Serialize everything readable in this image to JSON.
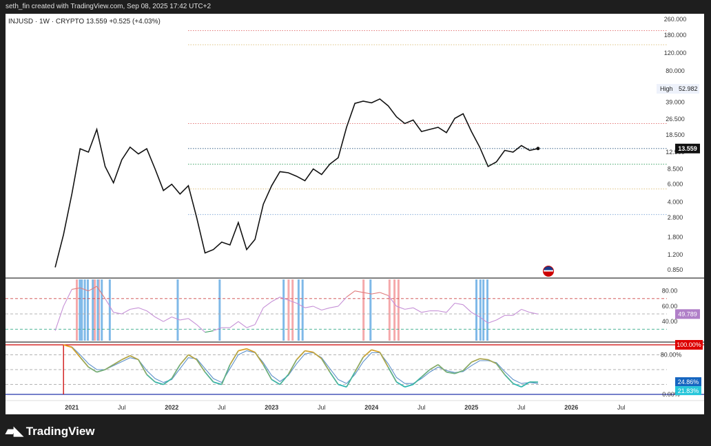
{
  "header_text": "seth_fin created with TradingView.com, Sep 08, 2025 17:42 UTC+2",
  "symbol_line": "INJUSD · 1W · CRYPTO  13.559  +0.525 (+4.03%)",
  "footer_brand": "TradingView",
  "colors": {
    "price_line": "#111111",
    "rsi_line": "#c58fd6",
    "rsi_overbought_line": "#e0797a",
    "rsi_oversold_line": "#2e9c5a",
    "overbought_marker": "#f5a9ab",
    "oversold_marker": "#7fb9e8",
    "stoch_signal": "#5b8fc9",
    "stoch_main_warm": "#f39c12",
    "stoch_main_cool": "#00bcd4"
  },
  "chart_data": [
    {
      "type": "line",
      "title": "INJUSD · 1W · CRYPTO",
      "y_scale": "log",
      "y_ticks": [
        "0.850",
        "1.200",
        "1.800",
        "2.800",
        "4.000",
        "6.000",
        "8.500",
        "12.500",
        "18.500",
        "26.500",
        "39.000",
        "52.982",
        "80.000",
        "120.000",
        "180.000",
        "260.000"
      ],
      "x_ticks": [
        "2021",
        "Jul",
        "2022",
        "Jul",
        "2023",
        "Jul",
        "2024",
        "Jul",
        "2025",
        "Jul",
        "2026",
        "Jul"
      ],
      "last_price_label": "13.559",
      "high_label": "High",
      "high_value": "52.982",
      "x": [
        "2020-11",
        "2020-12",
        "2021-01",
        "2021-02",
        "2021-03",
        "2021-04",
        "2021-05",
        "2021-06",
        "2021-07",
        "2021-08",
        "2021-09",
        "2021-10",
        "2021-11",
        "2021-12",
        "2022-01",
        "2022-02",
        "2022-03",
        "2022-04",
        "2022-05",
        "2022-06",
        "2022-07",
        "2022-08",
        "2022-09",
        "2022-10",
        "2022-11",
        "2022-12",
        "2023-01",
        "2023-02",
        "2023-03",
        "2023-04",
        "2023-05",
        "2023-06",
        "2023-07",
        "2023-08",
        "2023-09",
        "2023-10",
        "2023-11",
        "2023-12",
        "2024-01",
        "2024-02",
        "2024-03",
        "2024-04",
        "2024-05",
        "2024-06",
        "2024-07",
        "2024-08",
        "2024-09",
        "2024-10",
        "2024-11",
        "2024-12",
        "2025-01",
        "2025-02",
        "2025-03",
        "2025-04",
        "2025-05",
        "2025-06",
        "2025-07",
        "2025-08",
        "2025-09"
      ],
      "values": [
        0.9,
        1.9,
        4.8,
        13.5,
        12.5,
        21.0,
        9.0,
        6.2,
        10.5,
        14.0,
        12.0,
        13.5,
        8.5,
        5.2,
        6.0,
        4.8,
        5.8,
        2.8,
        1.25,
        1.35,
        1.6,
        1.5,
        2.5,
        1.35,
        1.7,
        3.8,
        5.8,
        8.0,
        7.8,
        7.2,
        6.5,
        8.5,
        7.5,
        9.5,
        11.0,
        22.0,
        38.0,
        40.0,
        38.5,
        42.0,
        36.0,
        28.0,
        24.0,
        26.0,
        20.0,
        21.0,
        22.0,
        19.5,
        27.0,
        30.0,
        20.0,
        14.0,
        9.0,
        10.0,
        13.0,
        12.5,
        14.5,
        13.0,
        13.56
      ],
      "reference_levels": [
        {
          "value": 200,
          "color": "#e06666"
        },
        {
          "value": 145,
          "color": "#d4b05a"
        },
        {
          "value": 24,
          "color": "#e06666"
        },
        {
          "value": 13.56,
          "color": "#1f4e79"
        },
        {
          "value": 9.5,
          "color": "#2e9c5a"
        },
        {
          "value": 5.4,
          "color": "#d4b05a"
        },
        {
          "value": 3.0,
          "color": "#5b8fc9"
        }
      ]
    },
    {
      "type": "line",
      "title": "",
      "y_ticks": [
        "40.00",
        "60.00",
        "80.00"
      ],
      "last_value_label": "49.789",
      "overbought": 70,
      "oversold": 30,
      "midline": 50,
      "values": [
        28,
        60,
        82,
        84,
        80,
        86,
        70,
        52,
        50,
        56,
        58,
        54,
        46,
        40,
        46,
        42,
        44,
        36,
        26,
        28,
        32,
        32,
        40,
        32,
        36,
        58,
        66,
        72,
        68,
        64,
        58,
        60,
        55,
        58,
        60,
        72,
        80,
        78,
        76,
        78,
        74,
        60,
        56,
        58,
        52,
        54,
        54,
        52,
        64,
        62,
        52,
        46,
        38,
        42,
        48,
        48,
        56,
        52,
        49.79
      ],
      "overbought_markers": [
        2021.05,
        2021.23,
        2021.27,
        2023.17,
        2023.21,
        2023.92,
        2024.18,
        2024.23,
        2024.27
      ],
      "oversold_markers": [
        2021.08,
        2021.1,
        2021.13,
        2021.16,
        2021.21,
        2021.26,
        2021.3,
        2021.38,
        2022.06,
        2022.48,
        2023.12,
        2023.27,
        2023.31,
        2023.99,
        2025.05,
        2025.09,
        2025.12,
        2025.16
      ]
    },
    {
      "type": "line",
      "title": "",
      "y_ticks": [
        "0.00%",
        "80.00%",
        "100.00%"
      ],
      "top_label": "100.00%",
      "main_label": "24.86%",
      "signal_label": "21.83%",
      "series": [
        {
          "values": [
            100,
            95,
            75,
            55,
            45,
            50,
            60,
            70,
            78,
            70,
            40,
            25,
            20,
            32,
            60,
            80,
            70,
            45,
            25,
            20,
            60,
            88,
            92,
            85,
            60,
            30,
            20,
            40,
            70,
            88,
            85,
            72,
            45,
            20,
            15,
            45,
            75,
            90,
            85,
            55,
            25,
            15,
            20,
            35,
            50,
            60,
            45,
            42,
            48,
            65,
            72,
            70,
            62,
            40,
            22,
            15,
            25,
            24.86
          ]
        },
        {
          "values": [
            100,
            96,
            80,
            62,
            50,
            50,
            58,
            66,
            74,
            70,
            48,
            32,
            24,
            30,
            52,
            74,
            72,
            52,
            32,
            24,
            52,
            80,
            88,
            84,
            64,
            38,
            26,
            38,
            62,
            82,
            84,
            74,
            52,
            30,
            22,
            40,
            66,
            84,
            84,
            62,
            34,
            22,
            22,
            32,
            45,
            55,
            48,
            44,
            46,
            58,
            68,
            68,
            64,
            46,
            30,
            22,
            24,
            21.83
          ]
        }
      ]
    }
  ]
}
